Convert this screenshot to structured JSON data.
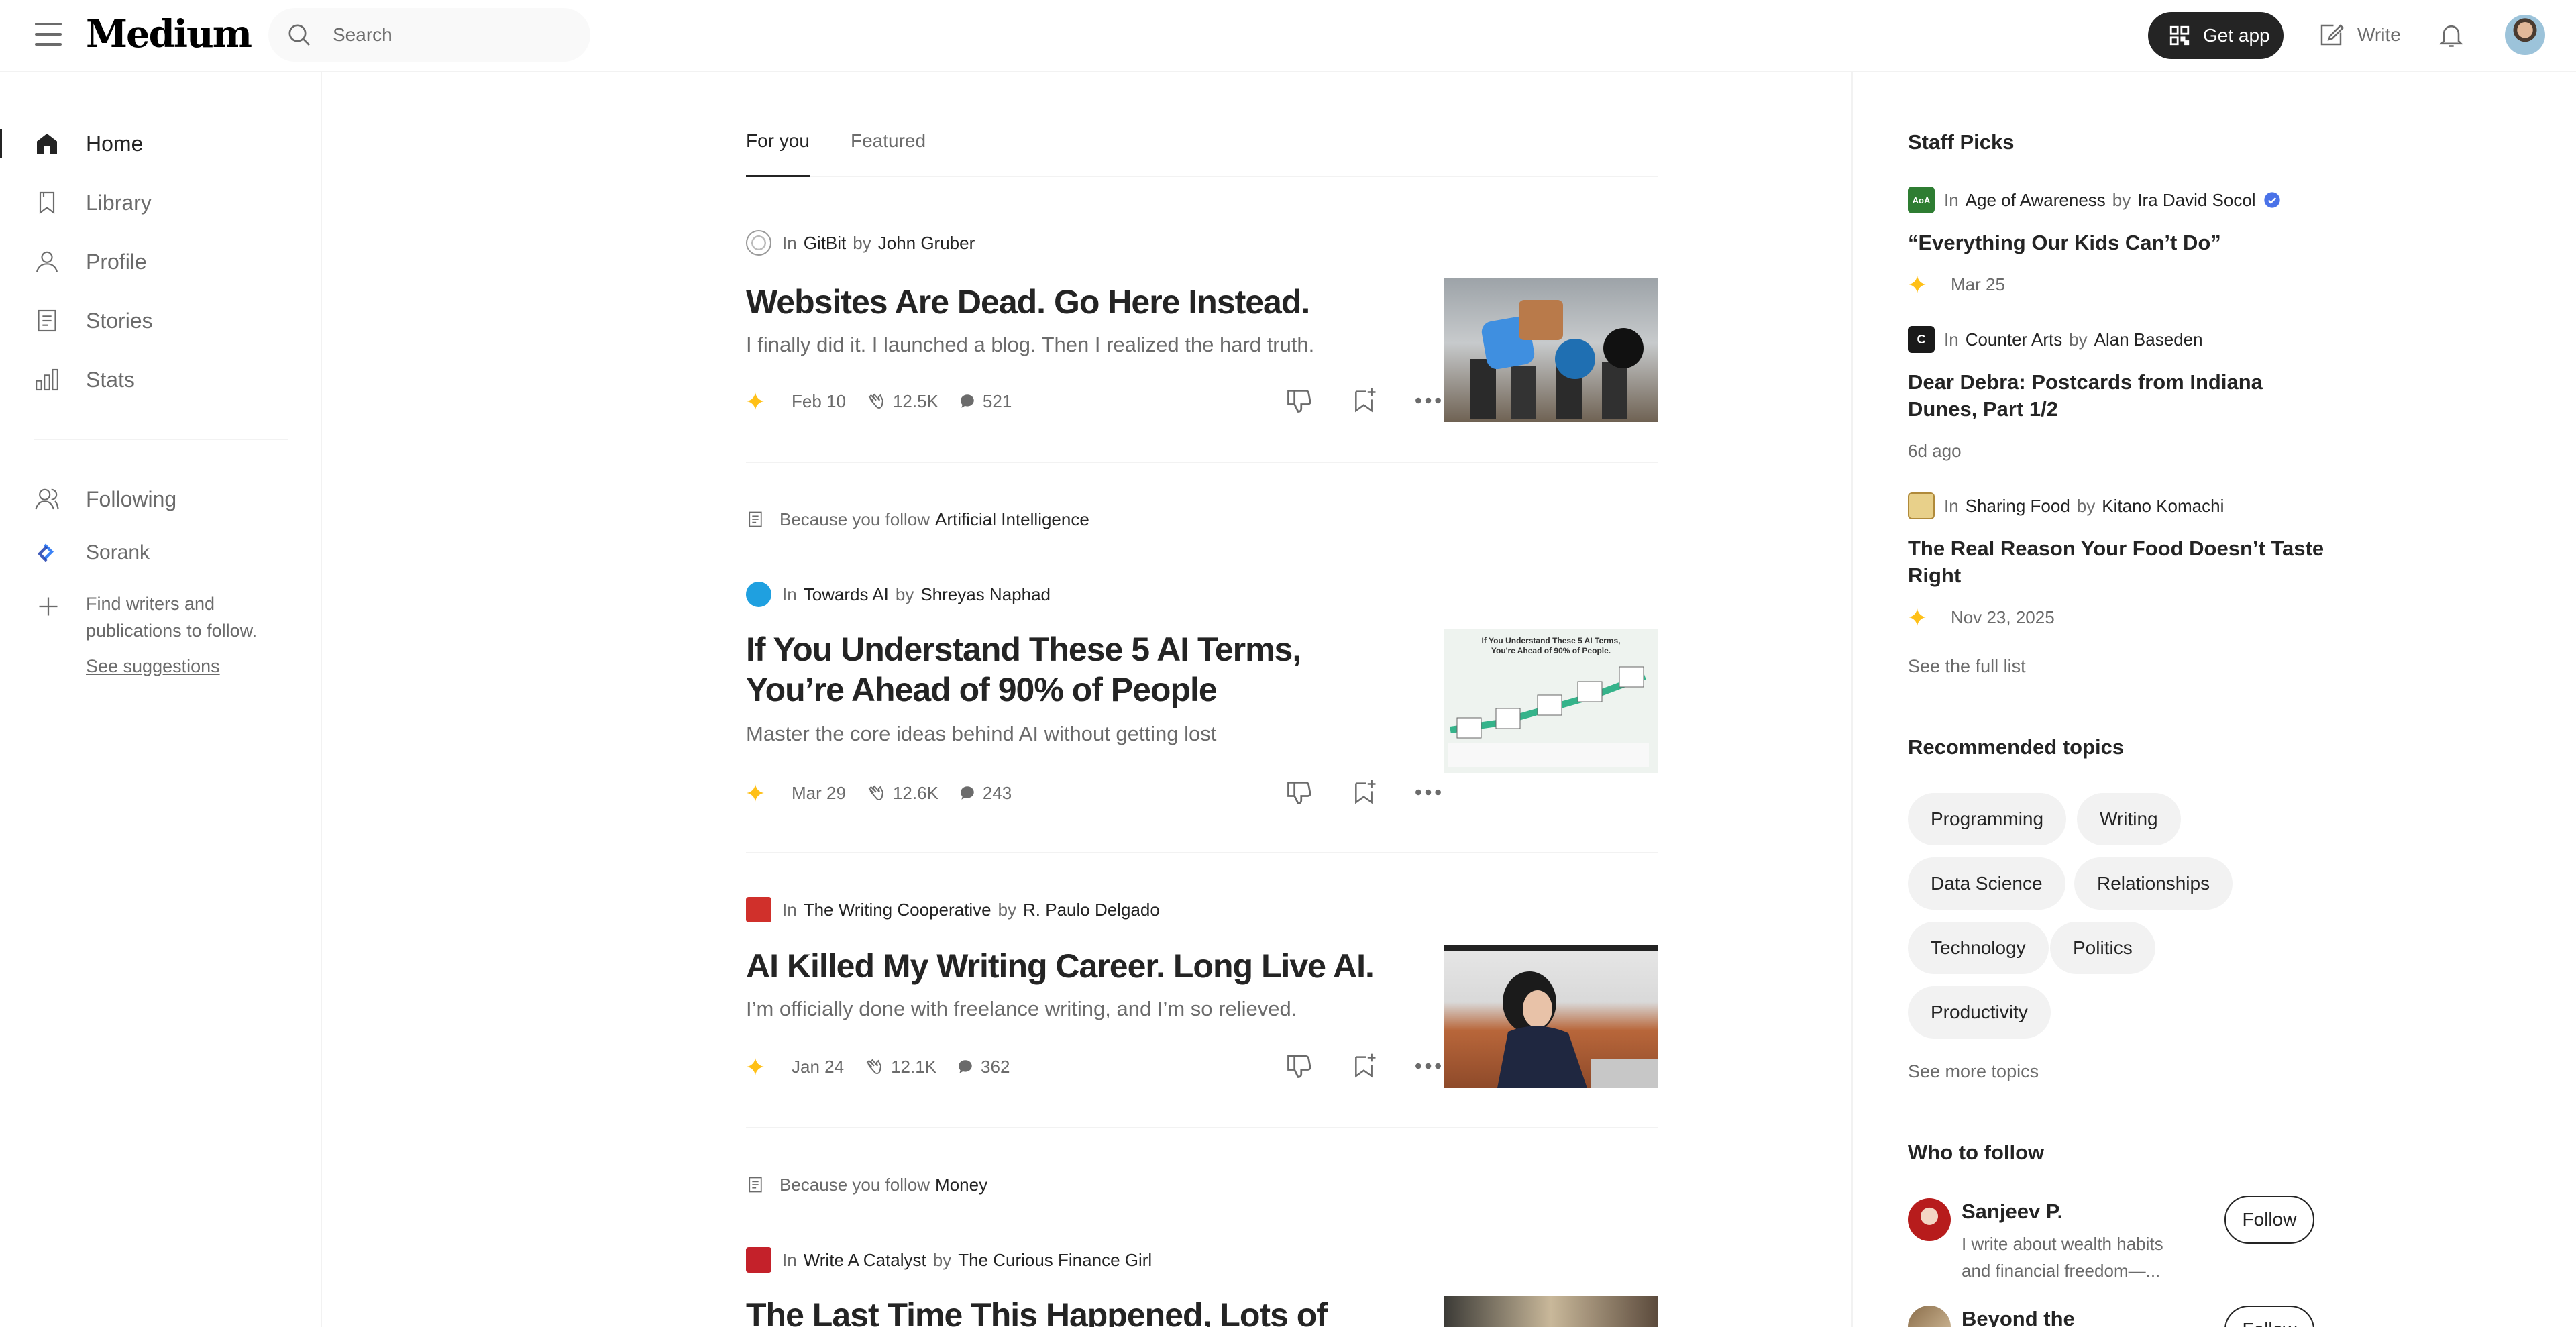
{
  "header": {
    "logo": "Medium",
    "search_placeholder": "Search",
    "get_app_label": "Get app",
    "write_label": "Write"
  },
  "sidebar": {
    "nav": [
      {
        "label": "Home",
        "icon": "home-icon",
        "active": true
      },
      {
        "label": "Library",
        "icon": "bookmark-icon"
      },
      {
        "label": "Profile",
        "icon": "profile-icon"
      },
      {
        "label": "Stories",
        "icon": "stories-icon"
      },
      {
        "label": "Stats",
        "icon": "stats-icon"
      }
    ],
    "following_label": "Following",
    "followed_pub": "Sorank",
    "find_text": "Find writers and publications to follow.",
    "see_suggestions": "See suggestions"
  },
  "feed": {
    "tabs": [
      "For you",
      "Featured"
    ],
    "articles": [
      {
        "because": "",
        "because_topic": "",
        "in_label": "In",
        "publication": "GitBit",
        "by_label": "by",
        "author": "John Gruber",
        "title": "Websites Are Dead. Go Here Instead.",
        "subtitle": "I finally did it. I launched a blog. Then I realized the hard truth.",
        "date": "Feb 10",
        "claps": "12.5K",
        "comments": "521"
      },
      {
        "because": "Because you follow",
        "because_topic": "Artificial Intelligence",
        "in_label": "In",
        "publication": "Towards AI",
        "by_label": "by",
        "author": "Shreyas Naphad",
        "title": "If You Understand These 5 AI Terms, You’re Ahead of 90% of People",
        "subtitle": "Master the core ideas behind AI without getting lost",
        "date": "Mar 29",
        "claps": "12.6K",
        "comments": "243",
        "thumb_caption": "If You Understand These 5 AI Terms, You're Ahead of 90% of People."
      },
      {
        "because": "",
        "because_topic": "",
        "in_label": "In",
        "publication": "The Writing Cooperative",
        "by_label": "by",
        "author": "R. Paulo Delgado",
        "title": "AI Killed My Writing Career. Long Live AI.",
        "subtitle": "I’m officially done with freelance writing, and I’m so relieved.",
        "date": "Jan 24",
        "claps": "12.1K",
        "comments": "362"
      },
      {
        "because": "Because you follow",
        "because_topic": "Money",
        "in_label": "In",
        "publication": "Write A Catalyst",
        "by_label": "by",
        "author": "The Curious Finance Girl",
        "title": "The Last Time This Happened, Lots of",
        "subtitle": "",
        "date": "",
        "claps": "",
        "comments": ""
      }
    ]
  },
  "right": {
    "staff_picks_title": "Staff Picks",
    "picks": [
      {
        "publication": "Age of Awareness",
        "author": "Ira David Socol",
        "title": "“Everything Our Kids Can’t Do”",
        "date": "Mar 25",
        "logo_text": "AoA"
      },
      {
        "publication": "Counter Arts",
        "author": "Alan Baseden",
        "title": "Dear Debra: Postcards from Indiana Dunes, Part 1/2",
        "date": "6d ago",
        "logo_text": "C"
      },
      {
        "publication": "Sharing Food",
        "author": "Kitano Komachi",
        "title": "The Real Reason Your Food Doesn’t Taste Right",
        "date": "Nov 23, 2025",
        "logo_text": ""
      }
    ],
    "in_label": "In",
    "by_label": "by",
    "see_full_list": "See the full list",
    "topics_title": "Recommended topics",
    "topics": [
      "Programming",
      "Writing",
      "Data Science",
      "Relationships",
      "Technology",
      "Politics",
      "Productivity"
    ],
    "see_more_topics": "See more topics",
    "who_title": "Who to follow",
    "who": [
      {
        "name": "Sanjeev P.",
        "bio": "I write about wealth habits and financial freedom—...",
        "follow": "Follow"
      },
      {
        "name": "Beyond the",
        "bio": "",
        "follow": "Follow"
      }
    ]
  },
  "colors": {
    "text": "#242424",
    "muted": "#6b6b6b",
    "divider": "#f2f2f2",
    "sparkle": "#ffc017",
    "member_badge": "#4a72e8"
  }
}
